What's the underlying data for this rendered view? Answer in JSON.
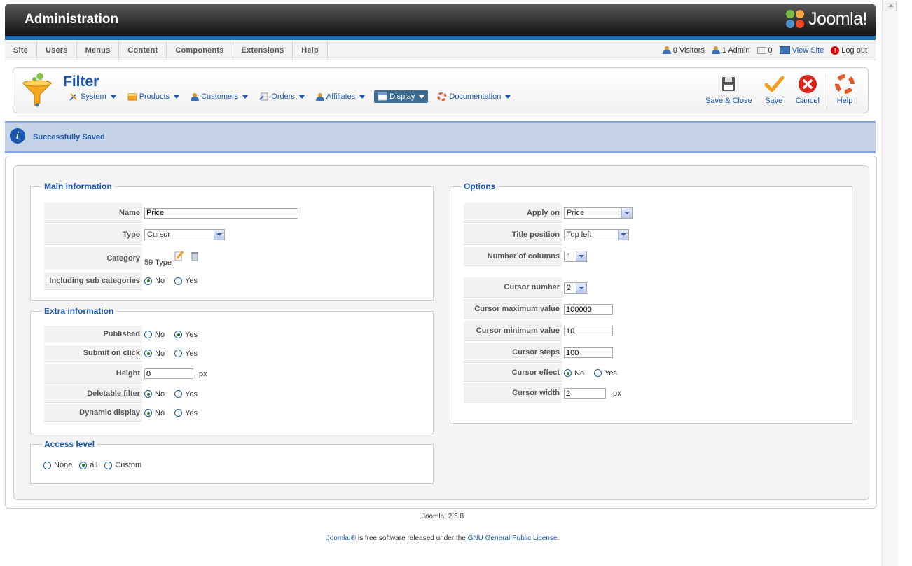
{
  "header": {
    "title": "Administration",
    "logo_text": "Joomla!"
  },
  "menu": [
    "Site",
    "Users",
    "Menus",
    "Content",
    "Components",
    "Extensions",
    "Help"
  ],
  "status": {
    "visitors": "0 Visitors",
    "admins": "1 Admin",
    "messages": "0",
    "view_site": "View Site",
    "logout": "Log out"
  },
  "page": {
    "title": "Filter"
  },
  "submenu": {
    "system": "System",
    "products": "Products",
    "customers": "Customers",
    "orders": "Orders",
    "affiliates": "Affiliates",
    "display": "Display",
    "documentation": "Documentation"
  },
  "toolbar": {
    "save_close": "Save & Close",
    "save": "Save",
    "cancel": "Cancel",
    "help": "Help"
  },
  "message": "Successfully Saved",
  "main_info": {
    "legend": "Main information",
    "name_label": "Name",
    "name_value": "Price",
    "type_label": "Type",
    "type_value": "Cursor",
    "category_label": "Category",
    "category_value": "59 Type",
    "subcat_label": "Including sub categories"
  },
  "extra_info": {
    "legend": "Extra information",
    "published_label": "Published",
    "submit_label": "Submit on click",
    "height_label": "Height",
    "height_value": "0",
    "height_unit": "px",
    "deletable_label": "Deletable filter",
    "dynamic_label": "Dynamic display"
  },
  "access": {
    "legend": "Access level",
    "none": "None",
    "all": "all",
    "custom": "Custom"
  },
  "radio": {
    "no": "No",
    "yes": "Yes"
  },
  "options": {
    "legend": "Options",
    "apply_label": "Apply on",
    "apply_value": "Price",
    "title_pos_label": "Title position",
    "title_pos_value": "Top left",
    "columns_label": "Number of columns",
    "columns_value": "1",
    "cursor_number_label": "Cursor number",
    "cursor_number_value": "2",
    "cursor_max_label": "Cursor maximum value",
    "cursor_max_value": "100000",
    "cursor_min_label": "Cursor minimum value",
    "cursor_min_value": "10",
    "cursor_steps_label": "Cursor steps",
    "cursor_steps_value": "100",
    "cursor_effect_label": "Cursor effect",
    "cursor_width_label": "Cursor width",
    "cursor_width_value": "2",
    "cursor_width_unit": "px"
  },
  "footer": {
    "version": "Joomla! 2.5.8",
    "link1": "Joomla!®",
    "text1": " is free software released under the ",
    "link2": "GNU General Public License",
    "text2": "."
  },
  "colors": {
    "accent": "#1b57b1",
    "header_dark": "#121212",
    "header_bar": "#1a6eb6",
    "message_bg": "#c3d2e5",
    "cancel_red": "#d9261c",
    "save_orange": "#f0a020"
  }
}
